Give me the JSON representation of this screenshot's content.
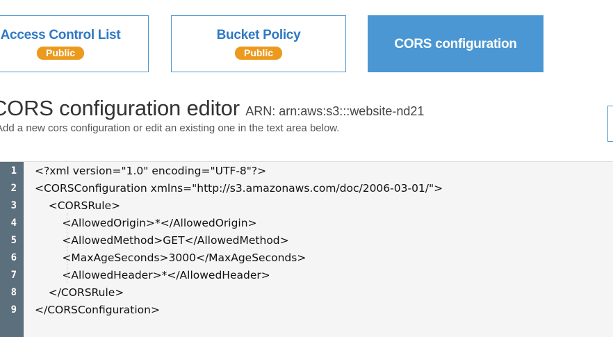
{
  "tabs": [
    {
      "label": "Access Control List",
      "badge": "Public"
    },
    {
      "label": "Bucket Policy",
      "badge": "Public"
    },
    {
      "label": "CORS configuration"
    }
  ],
  "editor": {
    "title": "CORS configuration editor",
    "arn": "ARN: arn:aws:s3:::website-nd21",
    "description": "Add a new cors configuration or edit an existing one in the text area below."
  },
  "code": {
    "lines": [
      {
        "n": "1",
        "text": "<?xml version=\"1.0\" encoding=\"UTF-8\"?>"
      },
      {
        "n": "2",
        "text": "<CORSConfiguration xmlns=\"http://s3.amazonaws.com/doc/2006-03-01/\">"
      },
      {
        "n": "3",
        "text": "    <CORSRule>"
      },
      {
        "n": "4",
        "text": "        <AllowedOrigin>*</AllowedOrigin>"
      },
      {
        "n": "5",
        "text": "        <AllowedMethod>GET</AllowedMethod>"
      },
      {
        "n": "6",
        "text": "        <MaxAgeSeconds>3000</MaxAgeSeconds>"
      },
      {
        "n": "7",
        "text": "        <AllowedHeader>*</AllowedHeader>"
      },
      {
        "n": "8",
        "text": "    </CORSRule>"
      },
      {
        "n": "9",
        "text": "</CORSConfiguration>"
      }
    ]
  },
  "colors": {
    "tab_border": "#4d97d3",
    "tab_active_bg": "#4a97d3",
    "tab_text": "#2f78c4",
    "badge_bg": "#ec9a1e",
    "gutter_bg": "#5b6f7d",
    "code_bg": "#f5f5f5"
  }
}
